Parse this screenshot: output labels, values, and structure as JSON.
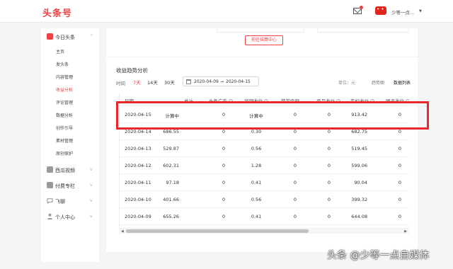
{
  "header": {
    "logo": "头条号",
    "username": "少等一点..."
  },
  "sidebar": {
    "groups": [
      {
        "label": "今日头条",
        "caret": "^",
        "icon_color": "#f04142"
      },
      {
        "label": "西瓜视频",
        "caret": "v",
        "icon_color": "#999999"
      },
      {
        "label": "付费专栏",
        "caret": "v",
        "icon_color": "#999999"
      },
      {
        "label": "飞聊",
        "caret": "v",
        "icon_color": "#999999"
      },
      {
        "label": "个人中心",
        "caret": "v",
        "icon_color": "#999999"
      }
    ],
    "items": [
      "主页",
      "发头条",
      "内容管理",
      "收益分析",
      "评论管理",
      "数据分析",
      "创作引导",
      "素材管理",
      "原创保护"
    ],
    "active_item": "收益分析"
  },
  "main": {
    "settle_button": "前往结算中心",
    "section_title": "收益趋势分析",
    "time_label": "时间",
    "range_tabs": [
      "7天",
      "14天",
      "30天"
    ],
    "active_range": "7天",
    "date_start": "2020-04-09",
    "date_sep": "→",
    "date_end": "2020-04-15",
    "unit": "单位：元",
    "view_tabs": [
      "趋势图",
      "数据列表"
    ],
    "active_view": "数据列表"
  },
  "table": {
    "headers": [
      "日期",
      "总计",
      "头条广告",
      "视频收益",
      "赞赏金额",
      "商品收益",
      "专栏收益",
      "圈子收益"
    ],
    "rows": [
      [
        "2020-04-15",
        "计算中",
        "0",
        "计算中",
        "0",
        "0",
        "913.42",
        "0"
      ],
      [
        "2020-04-14",
        "686.55",
        "0",
        "0.30",
        "0",
        "0",
        "682.75",
        "0"
      ],
      [
        "2020-04-13",
        "529.87",
        "0",
        "0.56",
        "0",
        "0",
        "519.45",
        "0"
      ],
      [
        "2020-04-12",
        "602.31",
        "0",
        "1.28",
        "0",
        "0",
        "599.06",
        "0"
      ],
      [
        "2020-04-11",
        "97.18",
        "0",
        "0.41",
        "0",
        "0",
        "90.04",
        "0"
      ],
      [
        "2020-04-10",
        "401.66",
        "0",
        "0.56",
        "0",
        "0",
        "399.32",
        "0"
      ],
      [
        "2020-04-09",
        "655.26",
        "0",
        "0.41",
        "0",
        "0",
        "644.08",
        "0"
      ]
    ]
  },
  "scroll": {
    "left_arrow": "◀",
    "right_arrow": "▶"
  },
  "watermark": "头条 @少等一点自媒体",
  "colors": {
    "brand": "#f04142",
    "highlight": "#e8282b"
  }
}
